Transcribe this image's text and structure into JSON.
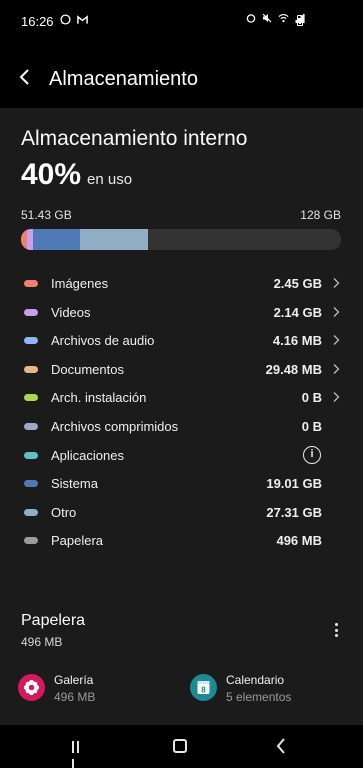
{
  "status_bar": {
    "time": "16:26",
    "left_icons": [
      "whatsapp-icon",
      "gmail-icon"
    ],
    "right_icons": [
      "alarm-icon",
      "mute-icon",
      "wifi-icon",
      "signal-icon",
      "battery-icon"
    ]
  },
  "header": {
    "title": "Almacenamiento"
  },
  "storage": {
    "title": "Almacenamiento interno",
    "percent": "40%",
    "percent_label": "en uso",
    "used": "51.43 GB",
    "total": "128 GB",
    "bar_segments": [
      {
        "name": "Imágenes",
        "fraction": 0.019,
        "color": "#f0816f"
      },
      {
        "name": "Videos",
        "fraction": 0.017,
        "color": "#c9a0f0"
      },
      {
        "name": "Sistema",
        "fraction": 0.148,
        "color": "#4f7ab5"
      },
      {
        "name": "Otro",
        "fraction": 0.214,
        "color": "#92aec6"
      }
    ]
  },
  "categories": [
    {
      "label": "Imágenes",
      "value": "2.45 GB",
      "color": "#f0816f",
      "has_chevron": true
    },
    {
      "label": "Videos",
      "value": "2.14 GB",
      "color": "#c9a0f0",
      "has_chevron": true
    },
    {
      "label": "Archivos de audio",
      "value": "4.16 MB",
      "color": "#8fb5f5",
      "has_chevron": true
    },
    {
      "label": "Documentos",
      "value": "29.48 MB",
      "color": "#e1b88e",
      "has_chevron": true
    },
    {
      "label": "Arch. instalación",
      "value": "0 B",
      "color": "#a6d94e",
      "has_chevron": true
    },
    {
      "label": "Archivos comprimidos",
      "value": "0 B",
      "color": "#9ea8c8",
      "has_chevron": false
    },
    {
      "label": "Aplicaciones",
      "value": "",
      "color": "#5ec0c4",
      "has_chevron": false,
      "info_icon": true
    },
    {
      "label": "Sistema",
      "value": "19.01 GB",
      "color": "#4f7ab5",
      "has_chevron": false
    },
    {
      "label": "Otro",
      "value": "27.31 GB",
      "color": "#92aec6",
      "has_chevron": false
    },
    {
      "label": "Papelera",
      "value": "496 MB",
      "color": "#9a9aa2",
      "has_chevron": false
    }
  ],
  "trash": {
    "title": "Papelera",
    "size": "496 MB",
    "apps": [
      {
        "name": "Galería",
        "sub": "496 MB",
        "icon": "gallery-icon",
        "color": "#d4195e"
      },
      {
        "name": "Calendario",
        "sub": "5 elementos",
        "icon": "calendar-icon",
        "color": "#1e8a93",
        "badge": "8"
      }
    ]
  }
}
